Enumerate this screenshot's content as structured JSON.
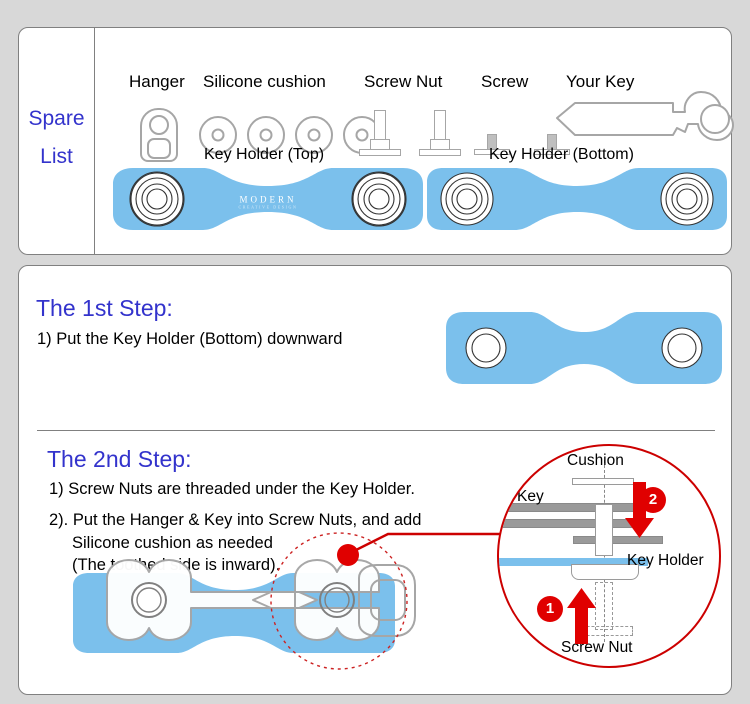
{
  "page": {
    "background_color": "#d8d8d8",
    "accent_blue": "#3333cc",
    "product_blue": "#7bc0ec",
    "red": "#cc0000"
  },
  "spare_list": {
    "label_line1": "Spare",
    "label_line2": "List",
    "parts": [
      {
        "name": "Hanger",
        "icon": "hanger-icon"
      },
      {
        "name": "Silicone cushion",
        "icon": "cushion-icon",
        "count": 4
      },
      {
        "name": "Screw Nut",
        "icon": "screw-nut-icon",
        "count": 2
      },
      {
        "name": "Screw",
        "icon": "screw-icon",
        "count": 2
      },
      {
        "name": "Your Key",
        "icon": "key-icon"
      }
    ],
    "holders": [
      {
        "label": "Key Holder (Top)",
        "brand_main": "MODERN",
        "brand_sub": "CREATIVE DESIGN"
      },
      {
        "label": "Key Holder (Bottom)"
      }
    ]
  },
  "steps": [
    {
      "title": "The 1st Step:",
      "lines": [
        "1)  Put the Key Holder (Bottom) downward"
      ]
    },
    {
      "title": "The 2nd Step:",
      "lines": [
        "1)  Screw Nuts are threaded under the Key Holder.",
        "2). Put the Hanger & Key into Screw Nuts, and add",
        "Silicone cushion as needed",
        "(The toothed side is inward)."
      ]
    }
  ],
  "magnifier": {
    "labels": {
      "cushion": "Cushion",
      "key": "Key",
      "key_holder": "Key Holder",
      "screw_nut": "Screw Nut"
    },
    "badges": [
      "1",
      "2"
    ],
    "arrow_down_meaning": "2",
    "arrow_up_meaning": "1"
  }
}
